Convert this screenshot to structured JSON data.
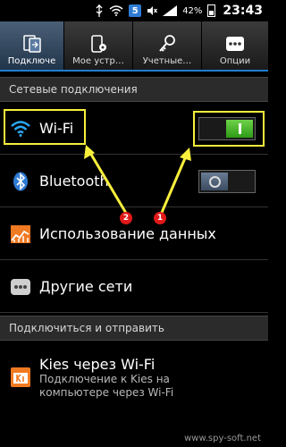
{
  "status_bar": {
    "notification_badge": "5",
    "battery_percent": "42%",
    "time": "23:43"
  },
  "tabs": [
    {
      "label": "Подключе",
      "icon": "connections-icon"
    },
    {
      "label": "Мое устр…",
      "icon": "my-device-icon"
    },
    {
      "label": "Учетные…",
      "icon": "accounts-icon"
    },
    {
      "label": "Опции",
      "icon": "more-options-icon"
    }
  ],
  "sections": {
    "network": "Сетевые подключения",
    "connect_share": "Подключиться и отправить"
  },
  "rows": {
    "wifi": {
      "label": "Wi-Fi",
      "enabled": true
    },
    "bluetooth": {
      "label": "Bluetooth",
      "enabled": false
    },
    "data_usage": {
      "label": "Использование данных"
    },
    "more_networks": {
      "label": "Другие сети"
    },
    "kies": {
      "title": "Kies через Wi-Fi",
      "subtitle_line1": "Подключение к Kies на",
      "subtitle_line2": "компьютере через Wi-Fi"
    }
  },
  "annotations": [
    "2",
    "1"
  ],
  "watermark": "www.spy-soft.net",
  "colors": {
    "accent": "#1e7fd0",
    "toggle_on": "#3fb51f",
    "highlight": "#f7ef3c",
    "annotation": "#e01919"
  }
}
